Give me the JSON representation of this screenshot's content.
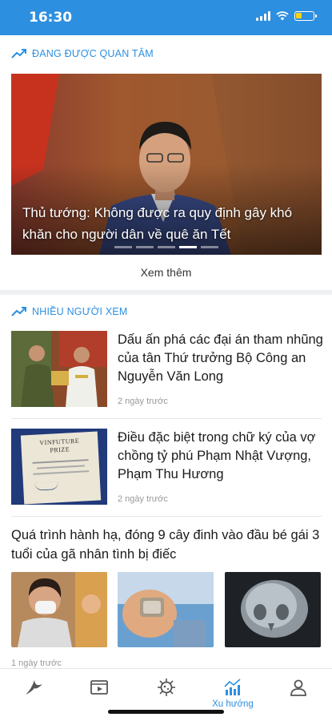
{
  "status_bar": {
    "time": "16:30",
    "battery_level": 0.35
  },
  "sections": {
    "trending": {
      "title": "ĐANG ĐƯỢC QUAN TÂM"
    },
    "most_viewed": {
      "title": "NHIỀU NGƯỜI XEM"
    }
  },
  "featured": {
    "title": "Thủ tướng: Không được ra quy định gây khó khăn cho người dân về quê ăn Tết",
    "slide_count": 5,
    "active_slide": 4
  },
  "see_more": "Xem thêm",
  "articles": [
    {
      "title": "Dấu ấn phá các đại án tham nhũng của tân Thứ trưởng Bộ Công an Nguyễn Văn Long",
      "time": "2 ngày trước"
    },
    {
      "title": "Điều đặc biệt trong chữ ký của vợ chồng tỷ phú Phạm Nhật Vượng, Phạm Thu Hương",
      "time": "2 ngày trước",
      "image_text": "VINFUTURE PRIZE"
    }
  ],
  "gallery_article": {
    "title": "Quá trình hành hạ, đóng 9 cây đinh vào đầu bé gái 3 tuổi của gã nhân tình bị điếc",
    "time": "1 ngày trước"
  },
  "bottom_nav": {
    "items": [
      {
        "icon": "logo-bird-icon",
        "label": ""
      },
      {
        "icon": "video-icon",
        "label": ""
      },
      {
        "icon": "virus-icon",
        "label": ""
      },
      {
        "icon": "trending-chart-icon",
        "label": "Xu hướng",
        "active": true
      },
      {
        "icon": "profile-icon",
        "label": ""
      }
    ]
  },
  "colors": {
    "accent": "#2d8fe0",
    "divider": "#eef0f2"
  }
}
